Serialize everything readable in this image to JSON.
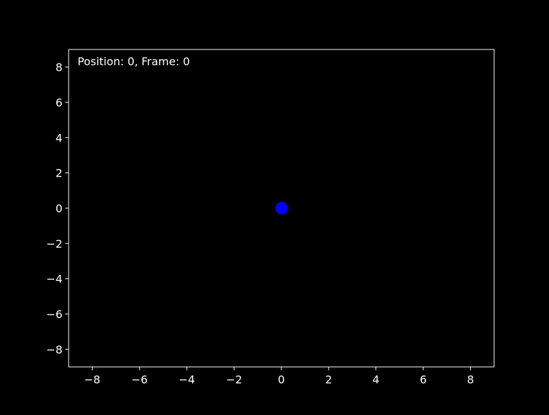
{
  "figure": {
    "background": "#000000",
    "foreground": "#ffffff"
  },
  "annotation": {
    "text": "Position: 0,  Frame: 0"
  },
  "chart_data": {
    "type": "scatter",
    "title": "",
    "xlabel": "",
    "ylabel": "",
    "xlim": [
      -9,
      9
    ],
    "ylim": [
      -9,
      9
    ],
    "xticks": [
      -8,
      -6,
      -4,
      -2,
      0,
      2,
      4,
      6,
      8
    ],
    "yticks": [
      -8,
      -6,
      -4,
      -2,
      0,
      2,
      4,
      6,
      8
    ],
    "xtick_labels": [
      "−8",
      "−6",
      "−4",
      "−2",
      "0",
      "2",
      "4",
      "6",
      "8"
    ],
    "ytick_labels": [
      "−8",
      "−6",
      "−4",
      "−2",
      "0",
      "2",
      "4",
      "6",
      "8"
    ],
    "grid": false,
    "series": [
      {
        "points": [
          {
            "x": 0,
            "y": 0
          }
        ],
        "color": "#0000ff",
        "marker": "circle"
      }
    ]
  }
}
